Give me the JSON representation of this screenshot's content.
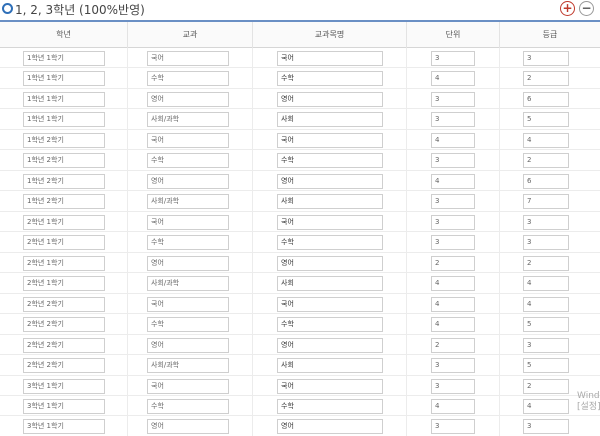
{
  "section": {
    "title": "1, 2, 3학년 (100%반영)"
  },
  "controls": {
    "add_symbol": "+",
    "remove_symbol": "−"
  },
  "table": {
    "headers": [
      "학년",
      "교과",
      "교과목명",
      "단위",
      "등급"
    ],
    "rows": [
      [
        "1학년 1학기",
        "국어",
        "국어",
        "3",
        "3"
      ],
      [
        "1학년 1학기",
        "수학",
        "수학",
        "4",
        "2"
      ],
      [
        "1학년 1학기",
        "영어",
        "영어",
        "3",
        "6"
      ],
      [
        "1학년 1학기",
        "사회/과학",
        "사회",
        "3",
        "5"
      ],
      [
        "1학년 2학기",
        "국어",
        "국어",
        "4",
        "4"
      ],
      [
        "1학년 2학기",
        "수학",
        "수학",
        "3",
        "2"
      ],
      [
        "1학년 2학기",
        "영어",
        "영어",
        "4",
        "6"
      ],
      [
        "1학년 2학기",
        "사회/과학",
        "사회",
        "3",
        "7"
      ],
      [
        "2학년 1학기",
        "국어",
        "국어",
        "3",
        "3"
      ],
      [
        "2학년 1학기",
        "수학",
        "수학",
        "3",
        "3"
      ],
      [
        "2학년 1학기",
        "영어",
        "영어",
        "2",
        "2"
      ],
      [
        "2학년 1학기",
        "사회/과학",
        "사회",
        "4",
        "4"
      ],
      [
        "2학년 2학기",
        "국어",
        "국어",
        "4",
        "4"
      ],
      [
        "2학년 2학기",
        "수학",
        "수학",
        "4",
        "5"
      ],
      [
        "2학년 2학기",
        "영어",
        "영어",
        "2",
        "3"
      ],
      [
        "2학년 2학기",
        "사회/과학",
        "사회",
        "3",
        "5"
      ],
      [
        "3학년 1학기",
        "국어",
        "국어",
        "3",
        "2"
      ],
      [
        "3학년 1학기",
        "수학",
        "수학",
        "4",
        "4"
      ],
      [
        "3학년 1학기",
        "영어",
        "영어",
        "3",
        "3"
      ]
    ]
  },
  "watermark": {
    "line1": "Wind",
    "line2": "[설정]"
  },
  "colors": {
    "accent": "#2e6fb8",
    "add_button": "#c0392b",
    "header_border": "#6a8fc4"
  }
}
